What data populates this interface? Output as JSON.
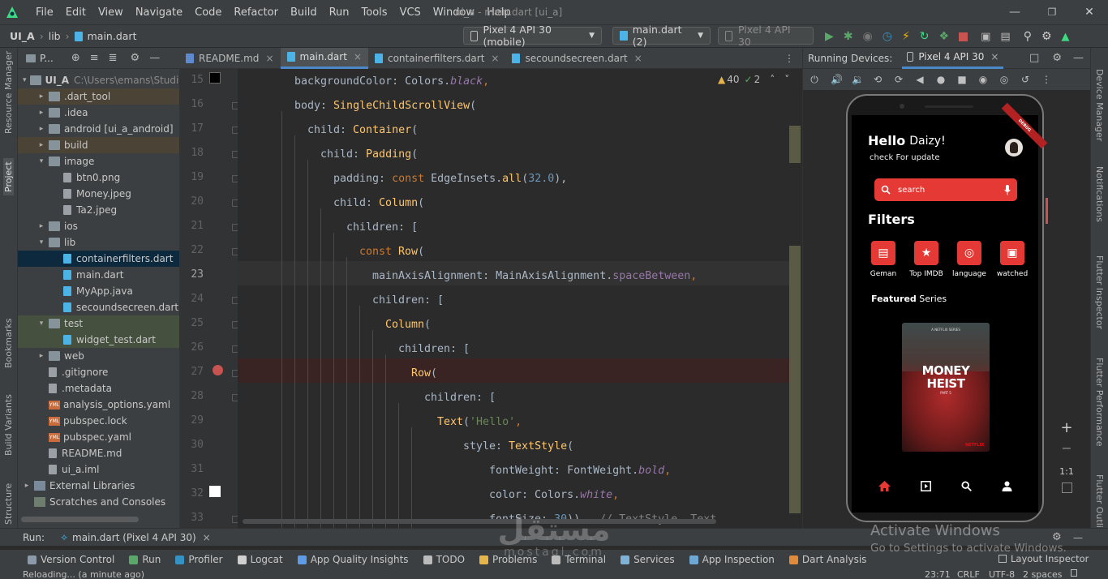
{
  "menu": [
    "File",
    "Edit",
    "View",
    "Navigate",
    "Code",
    "Refactor",
    "Build",
    "Run",
    "Tools",
    "VCS",
    "Window",
    "Help"
  ],
  "window_title": "ui_a - main.dart [ui_a]",
  "breadcrumb": {
    "project": "UI_A",
    "folder": "lib",
    "file": "main.dart"
  },
  "device_combo": "Pixel 4 API 30 (mobile)",
  "config_combo": "main.dart (2)",
  "target_combo": "Pixel 4 API 30",
  "left_stripe": {
    "resource_manager": "Resource Manager",
    "project": "Project",
    "bookmarks": "Bookmarks",
    "build_variants": "Build Variants",
    "structure": "Structure"
  },
  "right_stripe": {
    "device_manager": "Device Manager",
    "notifications": "Notifications",
    "flutter_inspector": "Flutter Inspector",
    "flutter_performance": "Flutter Performance",
    "flutter_outline": "Flutter Outline"
  },
  "project_panel": {
    "title": "P...",
    "items": [
      {
        "label": "UI_A",
        "path": "C:\\Users\\emans\\StudioP",
        "depth": 0,
        "arrow": "down",
        "type": "folder",
        "bold": true
      },
      {
        "label": ".dart_tool",
        "depth": 1,
        "arrow": "right",
        "type": "folder",
        "hl": "hl"
      },
      {
        "label": ".idea",
        "depth": 1,
        "arrow": "right",
        "type": "folder"
      },
      {
        "label": "android [ui_a_android]",
        "depth": 1,
        "arrow": "right",
        "type": "folder"
      },
      {
        "label": "build",
        "depth": 1,
        "arrow": "right",
        "type": "folder",
        "hl": "hl"
      },
      {
        "label": "image",
        "depth": 1,
        "arrow": "down",
        "type": "folder"
      },
      {
        "label": "btn0.png",
        "depth": 2,
        "type": "file"
      },
      {
        "label": "Money.jpeg",
        "depth": 2,
        "type": "file"
      },
      {
        "label": "Ta2.jpeg",
        "depth": 2,
        "type": "file"
      },
      {
        "label": "ios",
        "depth": 1,
        "arrow": "right",
        "type": "folder"
      },
      {
        "label": "lib",
        "depth": 1,
        "arrow": "down",
        "type": "folder"
      },
      {
        "label": "containerfilters.dart",
        "depth": 2,
        "type": "dart",
        "hl": "sel"
      },
      {
        "label": "main.dart",
        "depth": 2,
        "type": "dart"
      },
      {
        "label": "MyApp.java",
        "depth": 2,
        "type": "dart"
      },
      {
        "label": "secoundsecreen.dart",
        "depth": 2,
        "type": "dart"
      },
      {
        "label": "test",
        "depth": 1,
        "arrow": "down",
        "type": "folder",
        "hl": "hlg"
      },
      {
        "label": "widget_test.dart",
        "depth": 2,
        "type": "dart",
        "hl": "hlg"
      },
      {
        "label": "web",
        "depth": 1,
        "arrow": "right",
        "type": "folder"
      },
      {
        "label": ".gitignore",
        "depth": 1,
        "type": "file"
      },
      {
        "label": ".metadata",
        "depth": 1,
        "type": "file"
      },
      {
        "label": "analysis_options.yaml",
        "depth": 1,
        "type": "yml"
      },
      {
        "label": "pubspec.lock",
        "depth": 1,
        "type": "yml"
      },
      {
        "label": "pubspec.yaml",
        "depth": 1,
        "type": "yml"
      },
      {
        "label": "README.md",
        "depth": 1,
        "type": "file"
      },
      {
        "label": "ui_a.iml",
        "depth": 1,
        "type": "file"
      },
      {
        "label": "External Libraries",
        "depth": 0,
        "arrow": "right",
        "type": "lib"
      },
      {
        "label": "Scratches and Consoles",
        "depth": 0,
        "type": "scratch"
      }
    ]
  },
  "editor_tabs": [
    {
      "label": "README.md",
      "active": false
    },
    {
      "label": "main.dart",
      "active": true
    },
    {
      "label": "containerfilters.dart",
      "active": false
    },
    {
      "label": "secoundsecreen.dart",
      "active": false
    }
  ],
  "inspections": {
    "warnings": "40",
    "ok": "2"
  },
  "code_lines": [
    {
      "n": "15",
      "segs": [
        [
          "t",
          "backgroundColor: Colors."
        ],
        [
          "i",
          "black"
        ],
        [
          "pu",
          ","
        ]
      ]
    },
    {
      "n": "16",
      "segs": [
        [
          "t",
          "body: "
        ],
        [
          "c",
          "SingleChildScrollView"
        ],
        [
          "t",
          "("
        ]
      ]
    },
    {
      "n": "17",
      "segs": [
        [
          "t",
          "child: "
        ],
        [
          "c",
          "Container"
        ],
        [
          "t",
          "("
        ]
      ]
    },
    {
      "n": "18",
      "segs": [
        [
          "t",
          "child: "
        ],
        [
          "c",
          "Padding"
        ],
        [
          "t",
          "("
        ]
      ]
    },
    {
      "n": "19",
      "segs": [
        [
          "t",
          "padding: "
        ],
        [
          "k",
          "const "
        ],
        [
          "t",
          "EdgeInsets."
        ],
        [
          "c",
          "all"
        ],
        [
          "t",
          "("
        ],
        [
          "n",
          "32.0"
        ],
        [
          "t",
          "),"
        ]
      ]
    },
    {
      "n": "20",
      "segs": [
        [
          "t",
          "child: "
        ],
        [
          "c",
          "Column"
        ],
        [
          "t",
          "("
        ]
      ]
    },
    {
      "n": "21",
      "segs": [
        [
          "t",
          "children: ["
        ]
      ]
    },
    {
      "n": "22",
      "segs": [
        [
          "k",
          "const "
        ],
        [
          "c",
          "Row"
        ],
        [
          "t",
          "("
        ]
      ]
    },
    {
      "n": "23",
      "segs": [
        [
          "t",
          "mainAxisAlignment: MainAxisAlignment."
        ],
        [
          "p",
          "spaceBetween"
        ],
        [
          "pu",
          ","
        ]
      ]
    },
    {
      "n": "24",
      "segs": [
        [
          "t",
          "children: ["
        ]
      ]
    },
    {
      "n": "25",
      "segs": [
        [
          "c",
          "Column"
        ],
        [
          "t",
          "("
        ]
      ]
    },
    {
      "n": "26",
      "segs": [
        [
          "t",
          "children: ["
        ]
      ]
    },
    {
      "n": "27",
      "segs": [
        [
          "c",
          "Row"
        ],
        [
          "t",
          "("
        ]
      ]
    },
    {
      "n": "28",
      "segs": [
        [
          "t",
          "children: ["
        ]
      ]
    },
    {
      "n": "29",
      "segs": [
        [
          "c",
          "Text"
        ],
        [
          "t",
          "("
        ],
        [
          "s",
          "'Hello'"
        ],
        [
          "pu",
          ","
        ]
      ]
    },
    {
      "n": "30",
      "segs": [
        [
          "t",
          "style: "
        ],
        [
          "c",
          "TextStyle"
        ],
        [
          "t",
          "("
        ]
      ]
    },
    {
      "n": "31",
      "segs": [
        [
          "t",
          "fontWeight: FontWeight."
        ],
        [
          "i",
          "bold"
        ],
        [
          "pu",
          ","
        ]
      ]
    },
    {
      "n": "32",
      "segs": [
        [
          "t",
          "color: Colors."
        ],
        [
          "i",
          "white"
        ],
        [
          "pu",
          ","
        ]
      ]
    },
    {
      "n": "33",
      "segs": [
        [
          "t",
          "fontSize: "
        ],
        [
          "n",
          "30"
        ],
        [
          "t",
          "))"
        ],
        [
          "pu",
          ","
        ],
        [
          "cm",
          "  // TextStyle, Text"
        ]
      ]
    }
  ],
  "device_panel": {
    "title": "Running Devices:",
    "tab": "Pixel 4 API 30"
  },
  "phone_app": {
    "debug_banner": "DEBUG",
    "hello": "Hello",
    "name": "Daizy!",
    "subtitle": "check For update",
    "search_placeholder": "search",
    "filters_title": "Filters",
    "filters": [
      "Geman",
      "Top IMDB",
      "language",
      "watched"
    ],
    "featured_bold": "Featured",
    "featured_rest": " Series",
    "poster_small": "A NETFLIX SERIES",
    "poster_title_1": "MONEY",
    "poster_title_2": "HEIST",
    "poster_part": "PART 5",
    "poster_brand": "NETFLIX"
  },
  "zoom_controls": {
    "plus": "+",
    "minus": "−",
    "ratio": "1:1"
  },
  "run_bar": {
    "label": "Run:",
    "config": "main.dart (Pixel 4 API 30)"
  },
  "tool_windows": [
    "Version Control",
    "Run",
    "Profiler",
    "Logcat",
    "App Quality Insights",
    "TODO",
    "Problems",
    "Terminal",
    "Services",
    "App Inspection",
    "Dart Analysis"
  ],
  "layout_inspector": "Layout Inspector",
  "activate": {
    "title": "Activate Windows",
    "sub": "Go to Settings to activate Windows."
  },
  "watermark": {
    "arabic": "مستقل",
    "latin": "mostaql.com"
  },
  "status_bar": {
    "message": "Reloading... (a minute ago)",
    "position": "23:71",
    "line_sep": "CRLF",
    "encoding": "UTF-8",
    "indent": "2 spaces"
  },
  "colors": {
    "accent": "#e8383b",
    "bg": "#2b2b2b",
    "panel": "#3c3f41",
    "selection": "#0d293e"
  }
}
